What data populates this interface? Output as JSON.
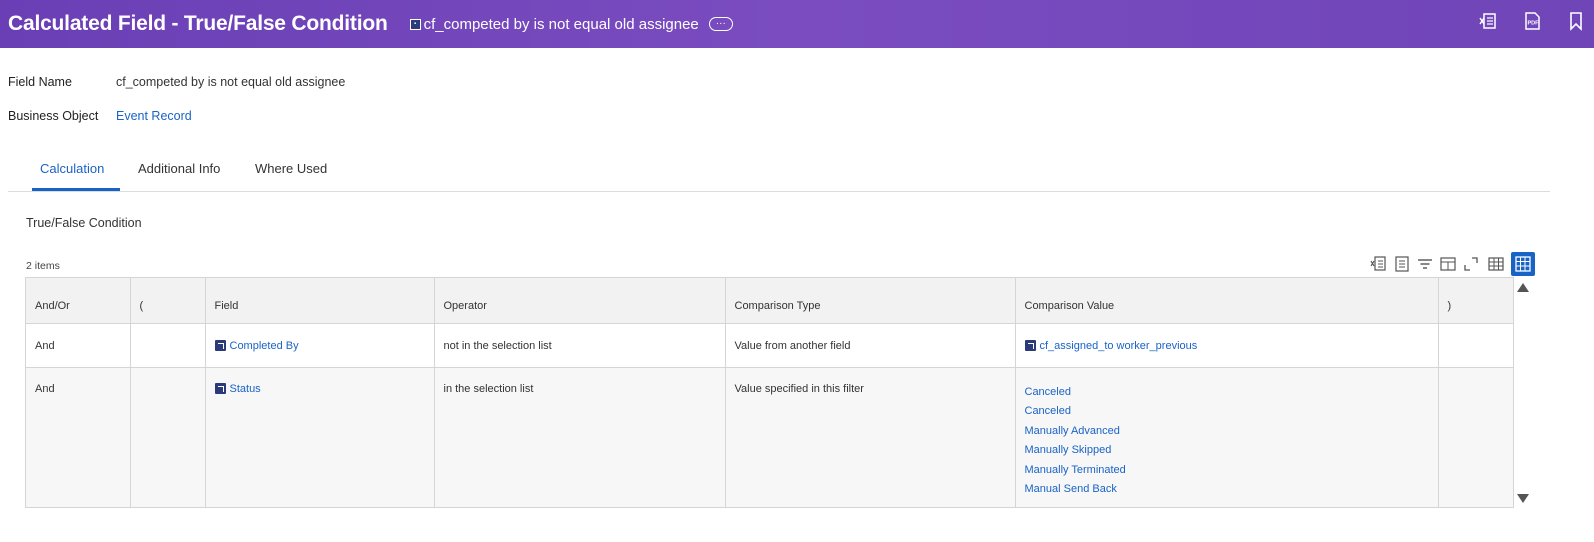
{
  "header": {
    "title": "Calculated Field - True/False Condition",
    "object_name": "cf_competed by is not equal old assignee",
    "related_actions_label": "···",
    "action_icons": [
      "export-to-excel-icon",
      "export-to-pdf-icon",
      "bookmark-icon"
    ]
  },
  "fields": {
    "field_name_label": "Field Name",
    "field_name_value": "cf_competed by is not equal old assignee",
    "business_object_label": "Business Object",
    "business_object_value": "Event Record"
  },
  "tabs": [
    {
      "label": "Calculation",
      "active": true
    },
    {
      "label": "Additional Info",
      "active": false
    },
    {
      "label": "Where Used",
      "active": false
    }
  ],
  "section_title": "True/False Condition",
  "items_count": "2 items",
  "table": {
    "columns": [
      "And/Or",
      "(",
      "Field",
      "Operator",
      "Comparison Type",
      "Comparison Value",
      ")"
    ],
    "rows": [
      {
        "and_or": "And",
        "open_paren": "",
        "field": "Completed By",
        "operator": "not in the selection list",
        "comparison_type": "Value from another field",
        "comparison_values": [
          "cf_assigned_to worker_previous"
        ],
        "close_paren": ""
      },
      {
        "and_or": "And",
        "open_paren": "",
        "field": "Status",
        "operator": "in the selection list",
        "comparison_type": "Value specified in this filter",
        "comparison_values": [
          "Canceled",
          "Canceled",
          "Manually Advanced",
          "Manually Skipped",
          "Manually Terminated",
          "Manual Send Back"
        ],
        "close_paren": ""
      }
    ]
  },
  "colors": {
    "header_gradient_start": "#6a3fb5",
    "header_gradient_end": "#6f45b8",
    "link": "#1a63c6",
    "field_icon": "#2b3a78"
  }
}
